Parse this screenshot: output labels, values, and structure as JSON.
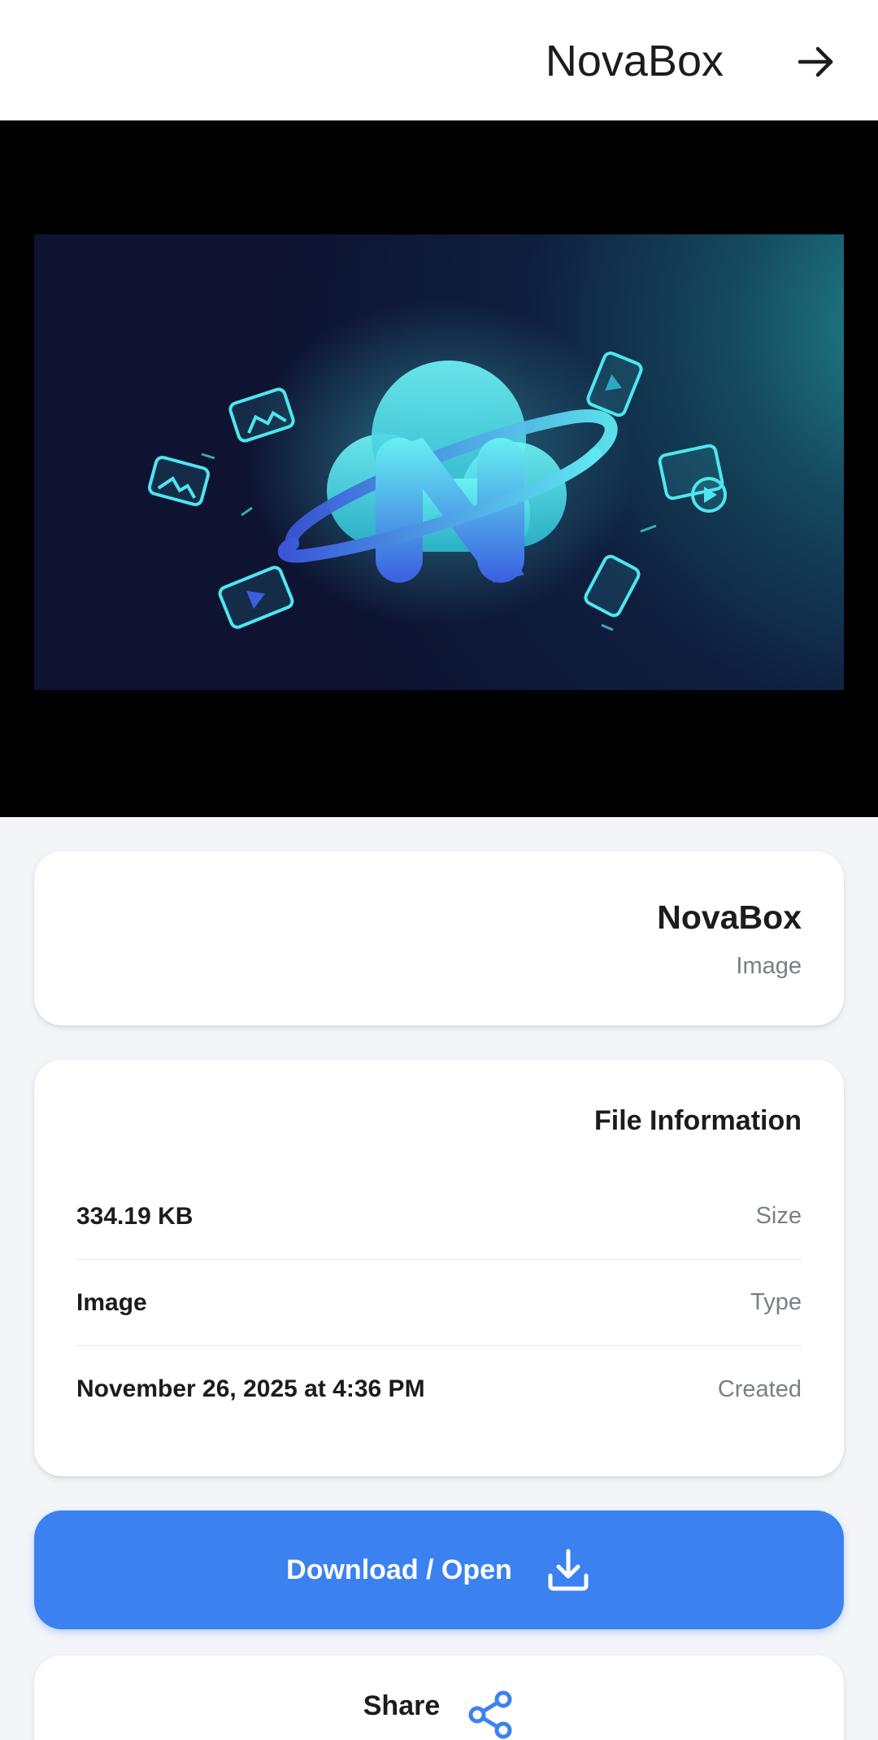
{
  "app_bar": {
    "title": "NovaBox",
    "back_icon": "arrow-right-icon"
  },
  "preview": {
    "image_subject": "NovaBox logo artwork: glowing cyan cloud with N letter and ring, surrounded by image, video and file icons",
    "accent_color": "#4ee6ef"
  },
  "file": {
    "name": "NovaBox",
    "kind": "Image"
  },
  "file_info": {
    "title": "File Information",
    "rows": [
      {
        "label": "Size",
        "value": "334.19 KB"
      },
      {
        "label": "Type",
        "value": "Image"
      },
      {
        "label": "Created",
        "value": "November 26, 2025 at 4:36 PM"
      }
    ]
  },
  "actions": {
    "download_label": "Download / Open",
    "download_icon": "download-icon",
    "share_label": "Share",
    "share_icon": "share-icon",
    "primary_color": "#3b82f0"
  }
}
